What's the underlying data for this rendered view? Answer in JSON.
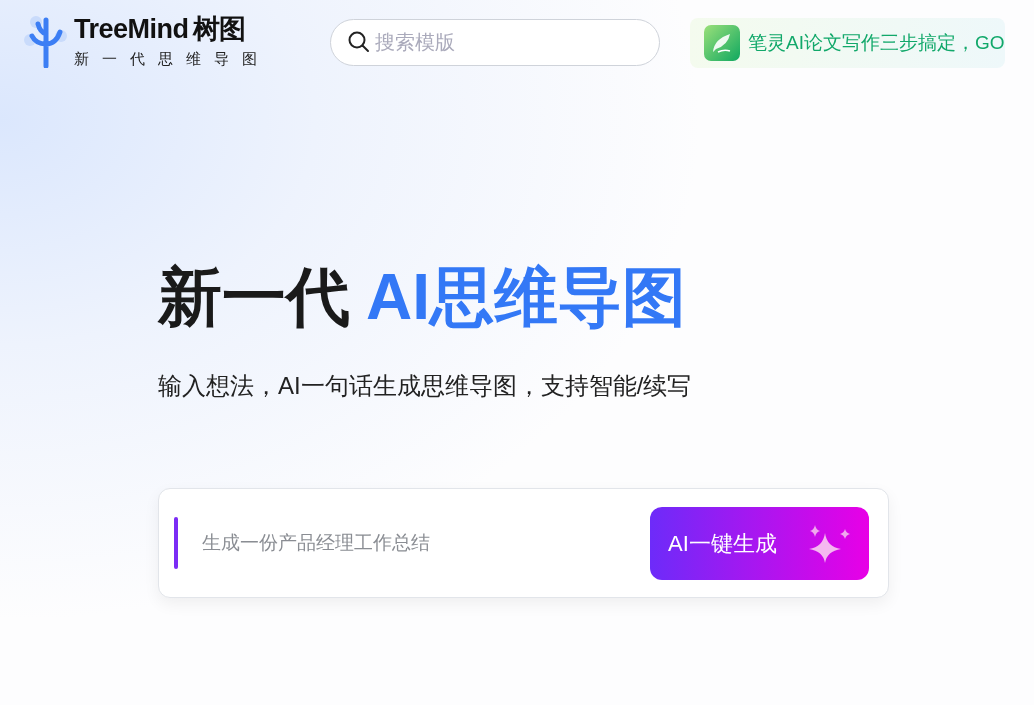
{
  "logo": {
    "name": "TreeMind",
    "name_cn": "树图",
    "tagline": "新一代思维导图"
  },
  "search": {
    "placeholder": "搜索模版"
  },
  "promo": {
    "text": "笔灵AI论文写作三步搞定，GO"
  },
  "hero": {
    "title": "新一代",
    "title_highlight": "AI思维导图",
    "subtitle": "输入想法，AI一句话生成思维导图，支持智能/续写"
  },
  "prompt": {
    "placeholder": "生成一份产品经理工作总结",
    "button": "AI一键生成"
  }
}
